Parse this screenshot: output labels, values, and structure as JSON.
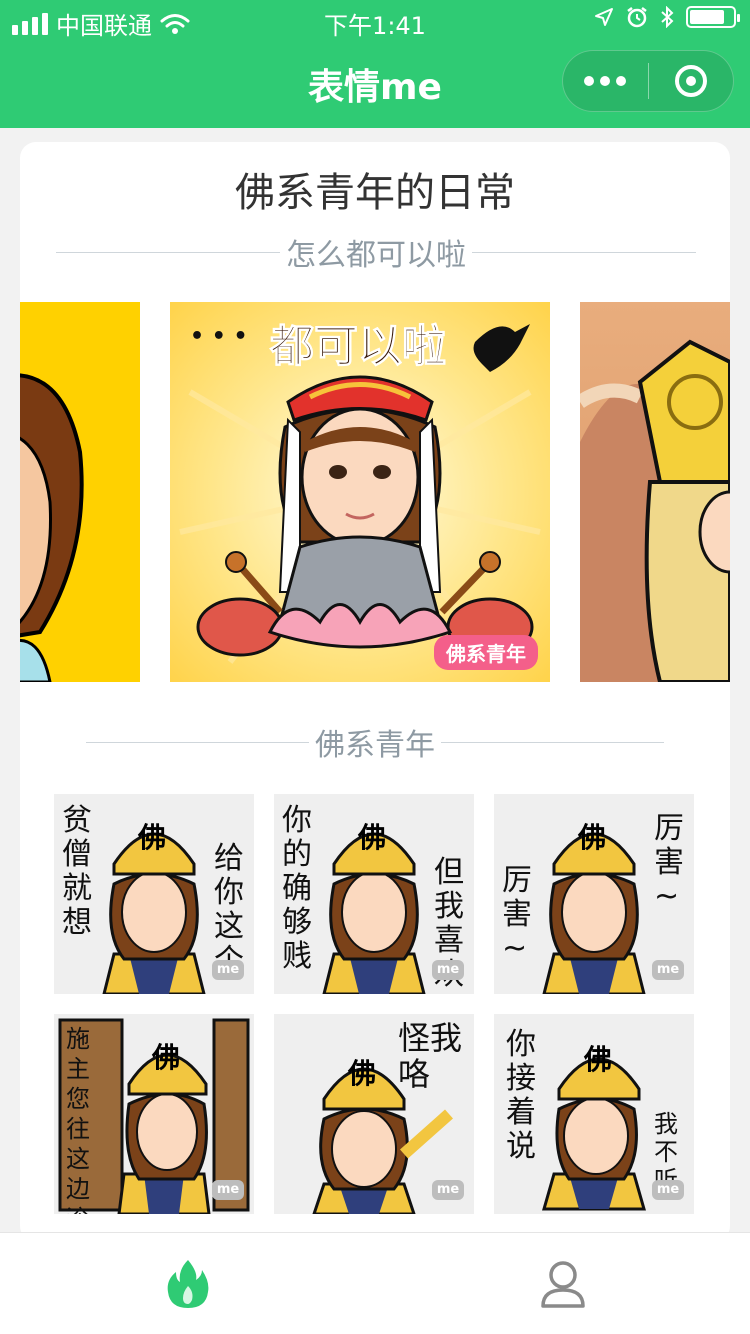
{
  "status_bar": {
    "carrier": "中国联通",
    "time": "下午1:41",
    "battery_level": 0.8
  },
  "nav": {
    "title": "表情me",
    "more_icon": "more-dots-icon",
    "close_icon": "target-circle-icon"
  },
  "card": {
    "title": "佛系青年的日常",
    "subtitle": "怎么都可以啦",
    "carousel": {
      "center_caption": "都可以啦",
      "center_tag": "佛系青年",
      "center_dots": "• • •"
    },
    "section_title": "佛系青年",
    "stickers": [
      {
        "text_left": "贫僧就想",
        "text_right": "给你这个",
        "badge": "me"
      },
      {
        "text_left": "你的确够贱",
        "text_right": "但我喜欢",
        "badge": "me"
      },
      {
        "text_left": "厉害~",
        "text_right": "厉害~",
        "badge": "me"
      },
      {
        "text_left": "施主您往这边滚",
        "text_right": "",
        "badge": "me"
      },
      {
        "text_left": "",
        "text_right": "怪我咯",
        "badge": "me"
      },
      {
        "text_left": "你接着说",
        "text_right": "我不听",
        "badge": "me"
      }
    ],
    "hat_char": "佛"
  },
  "tabbar": {
    "tabs": [
      {
        "icon": "flame-icon",
        "active": true
      },
      {
        "icon": "user-icon",
        "active": false
      }
    ],
    "accent": "#2fcb74"
  }
}
